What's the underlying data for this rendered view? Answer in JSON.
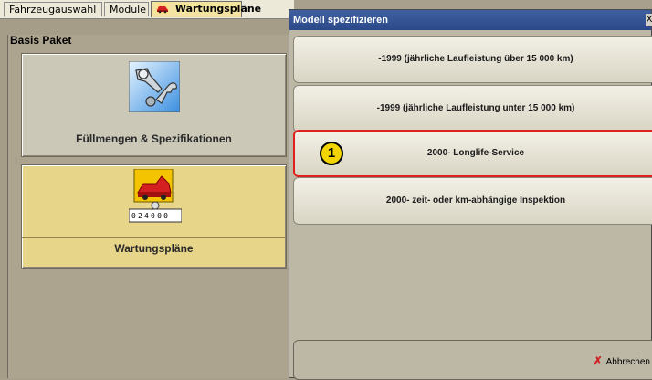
{
  "tabs": [
    {
      "label": "Fahrzeugauswahl"
    },
    {
      "label": "Module"
    },
    {
      "label": "Wartungspläne",
      "active": true
    }
  ],
  "section": {
    "title": "Basis Paket"
  },
  "tiles": [
    {
      "label": "Füllmengen & Spezifikationen",
      "icon": "wrench-icon"
    },
    {
      "label": "Wartungspläne",
      "icon": "car-service-icon",
      "odometer": "024000"
    }
  ],
  "dialog": {
    "title": "Modell spezifizieren",
    "close": "X",
    "options": [
      {
        "label": "-1999 (jährliche Laufleistung über 15 000 km)"
      },
      {
        "label": "-1999 (jährliche Laufleistung unter 15 000 km)"
      },
      {
        "label": "2000- Longlife-Service",
        "badge": "1",
        "highlighted": true
      },
      {
        "label": "2000- zeit- oder km-abhängige Inspektion"
      }
    ],
    "cancel_label": "Abbrechen"
  },
  "colors": {
    "highlight": "#e02020",
    "title_bar": "#2c4a88",
    "active_tile": "#e7d68a",
    "badge": "#f2d500"
  }
}
